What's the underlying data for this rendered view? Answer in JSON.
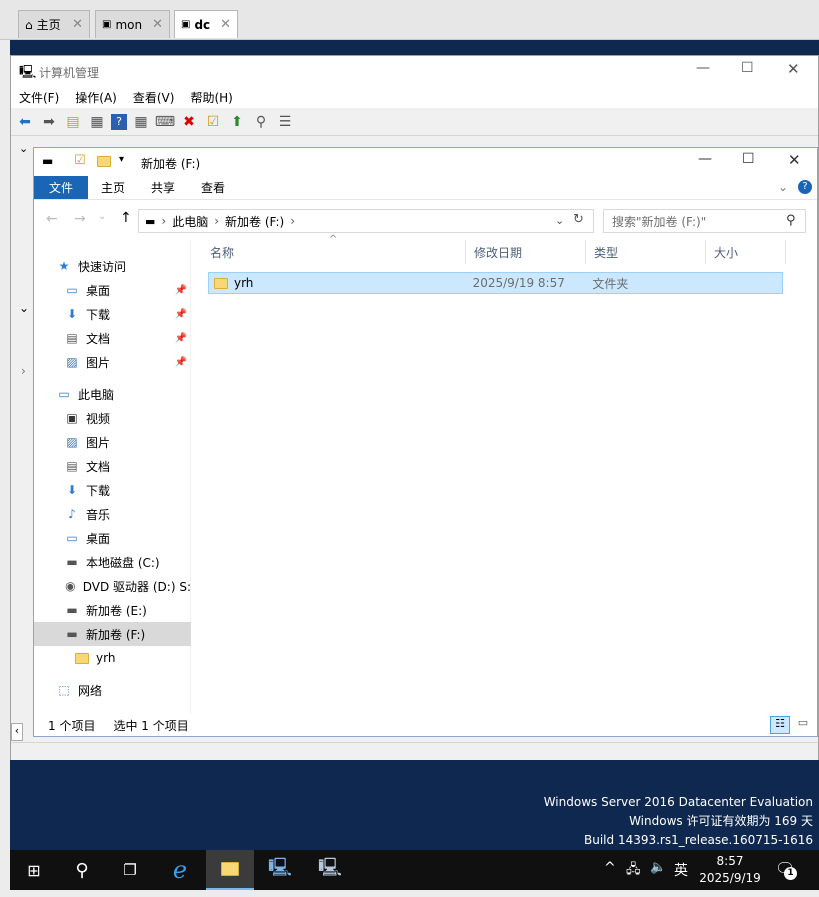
{
  "browser_tabs": [
    {
      "label": "主页",
      "icon": "home-icon"
    },
    {
      "label": "mon",
      "icon": "vm-icon"
    },
    {
      "label": "dc",
      "icon": "vm-icon"
    }
  ],
  "computer_management": {
    "title": "计算机管理",
    "menu": [
      "文件(F)",
      "操作(A)",
      "查看(V)",
      "帮助(H)"
    ]
  },
  "explorer": {
    "title": "新加卷 (F:)",
    "ribbon_tabs": [
      "文件",
      "主页",
      "共享",
      "查看"
    ],
    "address_parts": [
      "此电脑",
      "新加卷 (F:)"
    ],
    "search_placeholder": "搜索\"新加卷 (F:)\"",
    "nav": [
      {
        "label": "快速访问",
        "icon": "star-icon",
        "level": 0,
        "pinned": false,
        "selected": false
      },
      {
        "label": "桌面",
        "icon": "desktop-icon",
        "level": 1,
        "pinned": true,
        "selected": false
      },
      {
        "label": "下载",
        "icon": "download-icon",
        "level": 1,
        "pinned": true,
        "selected": false
      },
      {
        "label": "文档",
        "icon": "document-icon",
        "level": 1,
        "pinned": true,
        "selected": false
      },
      {
        "label": "图片",
        "icon": "picture-icon",
        "level": 1,
        "pinned": true,
        "selected": false
      },
      {
        "label": "此电脑",
        "icon": "computer-icon",
        "level": 0,
        "pinned": false,
        "selected": false
      },
      {
        "label": "视频",
        "icon": "video-icon",
        "level": 1,
        "pinned": false,
        "selected": false
      },
      {
        "label": "图片",
        "icon": "picture-icon",
        "level": 1,
        "pinned": false,
        "selected": false
      },
      {
        "label": "文档",
        "icon": "document-icon",
        "level": 1,
        "pinned": false,
        "selected": false
      },
      {
        "label": "下载",
        "icon": "download-icon",
        "level": 1,
        "pinned": false,
        "selected": false
      },
      {
        "label": "音乐",
        "icon": "music-icon",
        "level": 1,
        "pinned": false,
        "selected": false
      },
      {
        "label": "桌面",
        "icon": "desktop-icon",
        "level": 1,
        "pinned": false,
        "selected": false
      },
      {
        "label": "本地磁盘 (C:)",
        "icon": "disk-icon",
        "level": 1,
        "pinned": false,
        "selected": false
      },
      {
        "label": "DVD 驱动器 (D:) S:",
        "icon": "dvd-icon",
        "level": 1,
        "pinned": false,
        "selected": false
      },
      {
        "label": "新加卷 (E:)",
        "icon": "drive-icon",
        "level": 1,
        "pinned": false,
        "selected": false
      },
      {
        "label": "新加卷 (F:)",
        "icon": "drive-icon",
        "level": 1,
        "pinned": false,
        "selected": true
      },
      {
        "label": "yrh",
        "icon": "folder-icon",
        "level": 2,
        "pinned": false,
        "selected": false
      },
      {
        "label": "网络",
        "icon": "network-icon",
        "level": 0,
        "pinned": false,
        "selected": false
      }
    ],
    "columns": [
      "名称",
      "修改日期",
      "类型",
      "大小"
    ],
    "files": [
      {
        "name": "yrh",
        "modified": "2025/9/19 8:57",
        "type": "文件夹",
        "size": ""
      }
    ],
    "status": {
      "count": "1 个项目",
      "selected": "选中 1 个项目"
    }
  },
  "watermark": [
    "Windows Server 2016 Datacenter Evaluation",
    "Windows 许可证有效期为 169 天",
    "Build 14393.rs1_release.160715-1616"
  ],
  "taskbar": {
    "ime": "英",
    "time": "8:57",
    "date": "2025/9/19",
    "notification_count": "1"
  },
  "colors": {
    "accent": "#1a65b5",
    "selection": "#cce8ff",
    "desktop": "#0f2850",
    "taskbar": "#101010"
  }
}
